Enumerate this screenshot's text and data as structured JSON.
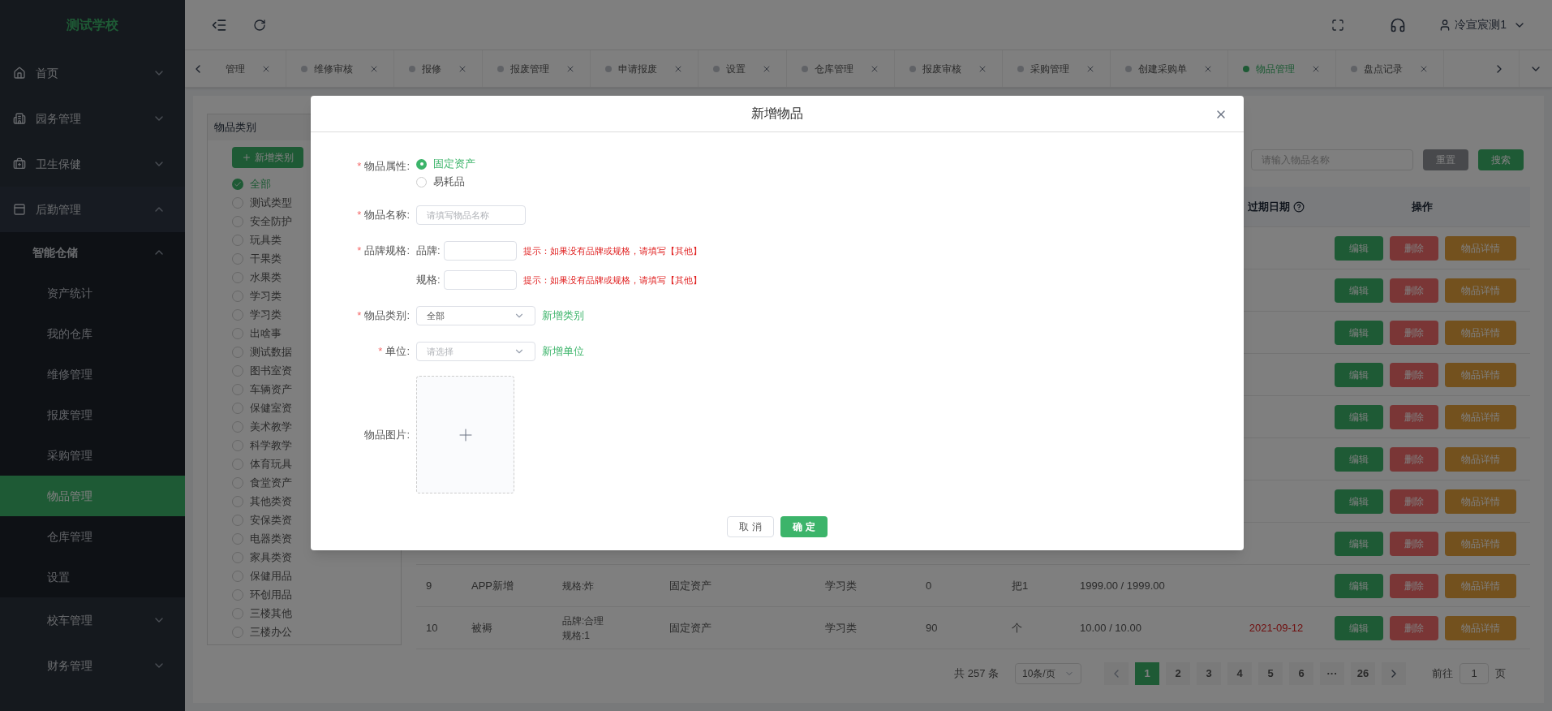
{
  "sidebar": {
    "logo": "测试学校",
    "items": [
      {
        "label": "首页",
        "expanded": false
      },
      {
        "label": "园务管理",
        "expanded": false
      },
      {
        "label": "卫生保健",
        "expanded": false
      },
      {
        "label": "后勤管理",
        "expanded": true,
        "children": [
          {
            "label": "智能仓储",
            "expanded": true,
            "children": [
              {
                "label": "资产统计",
                "selected": false
              },
              {
                "label": "我的仓库",
                "selected": false
              },
              {
                "label": "维修管理",
                "selected": false
              },
              {
                "label": "报废管理",
                "selected": false
              },
              {
                "label": "采购管理",
                "selected": false
              },
              {
                "label": "物品管理",
                "selected": true
              },
              {
                "label": "仓库管理",
                "selected": false
              },
              {
                "label": "设置",
                "selected": false
              }
            ]
          }
        ]
      },
      {
        "label": "校车管理",
        "expanded": false
      },
      {
        "label": "财务管理",
        "expanded": false
      }
    ]
  },
  "header": {
    "user": "冷宣宸测1"
  },
  "tabs": [
    {
      "label": "管理",
      "selected": false,
      "dot": false
    },
    {
      "label": "维修审核",
      "selected": false,
      "dot": true
    },
    {
      "label": "报修",
      "selected": false,
      "dot": true
    },
    {
      "label": "报废管理",
      "selected": false,
      "dot": true
    },
    {
      "label": "申请报废",
      "selected": false,
      "dot": true
    },
    {
      "label": "设置",
      "selected": false,
      "dot": true
    },
    {
      "label": "仓库管理",
      "selected": false,
      "dot": true
    },
    {
      "label": "报废审核",
      "selected": false,
      "dot": true
    },
    {
      "label": "采购管理",
      "selected": false,
      "dot": true
    },
    {
      "label": "创建采购单",
      "selected": false,
      "dot": true
    },
    {
      "label": "物品管理",
      "selected": true,
      "dot": true
    },
    {
      "label": "盘点记录",
      "selected": false,
      "dot": true
    }
  ],
  "category_panel": {
    "title": "物品类别",
    "add_button": "新增类别",
    "items": [
      {
        "label": "全部",
        "selected": true
      },
      {
        "label": "测试类型",
        "selected": false
      },
      {
        "label": "安全防护",
        "selected": false
      },
      {
        "label": "玩具类",
        "selected": false
      },
      {
        "label": "干果类",
        "selected": false
      },
      {
        "label": "水果类",
        "selected": false
      },
      {
        "label": "学习类",
        "selected": false
      },
      {
        "label": "学习类",
        "selected": false
      },
      {
        "label": "出啥事",
        "selected": false
      },
      {
        "label": "测试数据",
        "selected": false
      },
      {
        "label": "图书室资",
        "selected": false
      },
      {
        "label": "车辆资产",
        "selected": false
      },
      {
        "label": "保健室资",
        "selected": false
      },
      {
        "label": "美术教学",
        "selected": false
      },
      {
        "label": "科学教学",
        "selected": false
      },
      {
        "label": "体育玩具",
        "selected": false
      },
      {
        "label": "食堂资产",
        "selected": false
      },
      {
        "label": "其他类资",
        "selected": false
      },
      {
        "label": "安保类资",
        "selected": false
      },
      {
        "label": "电器类资",
        "selected": false
      },
      {
        "label": "家具类资",
        "selected": false
      },
      {
        "label": "保健用品",
        "selected": false
      },
      {
        "label": "环创用品",
        "selected": false
      },
      {
        "label": "三楼其他",
        "selected": false
      },
      {
        "label": "三楼办公",
        "selected": false
      }
    ]
  },
  "search": {
    "placeholder": "请输入物品名称",
    "reset": "重置",
    "submit": "搜索"
  },
  "table": {
    "columns": [
      {
        "label": "过期日期",
        "help": true
      },
      {
        "label": "操作",
        "help": false
      }
    ],
    "rows": [
      {
        "actions": [
          "编辑",
          "删除",
          "物品详情"
        ]
      },
      {
        "actions": [
          "编辑",
          "删除",
          "物品详情"
        ]
      },
      {
        "actions": [
          "编辑",
          "删除",
          "物品详情"
        ]
      },
      {
        "actions": [
          "编辑",
          "删除",
          "物品详情"
        ]
      },
      {
        "actions": [
          "编辑",
          "删除",
          "物品详情"
        ]
      },
      {
        "actions": [
          "编辑",
          "删除",
          "物品详情"
        ]
      },
      {
        "actions": [
          "编辑",
          "删除",
          "物品详情"
        ]
      },
      {
        "actions": [
          "编辑",
          "删除",
          "物品详情"
        ]
      },
      {
        "index": "9",
        "name": "APP新增",
        "spec": "规格:炸",
        "type": "固定资产",
        "category": "学习类",
        "quantity": "0",
        "unit": "把1",
        "price": "1999.00 / 1999.00",
        "actions": [
          "编辑",
          "删除",
          "物品详情"
        ]
      },
      {
        "index": "10",
        "name": "被褥",
        "brand": "品牌:合理",
        "spec": "规格:1",
        "type": "固定资产",
        "category": "学习类",
        "quantity": "90",
        "unit": "个",
        "price": "10.00 / 10.00",
        "expiry": "2021-09-12",
        "expired": true,
        "actions": [
          "编辑",
          "删除",
          "物品详情"
        ]
      }
    ]
  },
  "pagination": {
    "total": "共 257 条",
    "page_size": "10条/页",
    "pages": [
      {
        "label": "1",
        "selected": true
      },
      {
        "label": "2",
        "selected": false
      },
      {
        "label": "3",
        "selected": false
      },
      {
        "label": "4",
        "selected": false
      },
      {
        "label": "5",
        "selected": false
      },
      {
        "label": "6",
        "selected": false
      },
      {
        "label": "···",
        "selected": false
      },
      {
        "label": "26",
        "selected": false
      }
    ],
    "goto_label": "前往",
    "goto_value": "1",
    "goto_suffix": "页"
  },
  "modal": {
    "title": "新增物品",
    "fields": [
      {
        "kind": "radio",
        "label": "物品属性:",
        "required": "*",
        "options": [
          {
            "label": "固定资产",
            "selected": true
          },
          {
            "label": "易耗品",
            "selected": false
          }
        ]
      },
      {
        "kind": "input",
        "label": "物品名称:",
        "required": "*",
        "placeholder": "请填写物品名称"
      },
      {
        "kind": "brand_spec",
        "label": "品牌规格:",
        "required": "*",
        "rows": [
          {
            "label": "品牌:",
            "hint": "提示：如果没有品牌或规格，请填写【其他】"
          },
          {
            "label": "规格:",
            "hint": "提示：如果没有品牌或规格，请填写【其他】"
          }
        ]
      },
      {
        "kind": "select",
        "label": "物品类别:",
        "required": "*",
        "value": "全部",
        "link": "新增类别"
      },
      {
        "kind": "select",
        "label": "单位:",
        "required": "*",
        "placeholder": "请选择",
        "link": "新增单位"
      },
      {
        "kind": "upload",
        "label": "物品图片:"
      }
    ],
    "cancel": "取 消",
    "confirm": "确 定"
  }
}
